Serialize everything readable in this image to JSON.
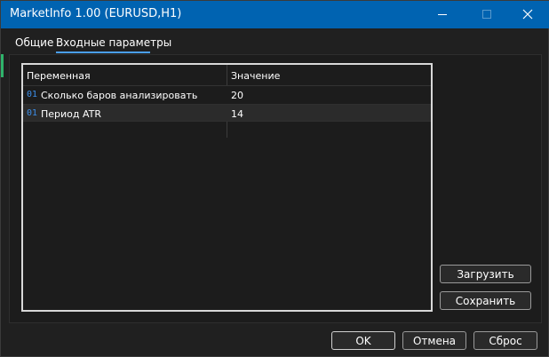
{
  "window": {
    "title": "MarketInfo 1.00 (EURUSD,H1)"
  },
  "titlebar_buttons": {
    "minimize": "minimize-icon",
    "maximize": "maximize-icon",
    "close": "close-icon"
  },
  "tabs": [
    {
      "label": "Общие",
      "active": false
    },
    {
      "label": "Входные параметры",
      "active": true
    }
  ],
  "table": {
    "columns": [
      "Переменная",
      "Значение"
    ],
    "rows": [
      {
        "type_icon": "01",
        "name": "Сколько баров анализировать",
        "value": "20"
      },
      {
        "type_icon": "01",
        "name": "Период ATR",
        "value": "14"
      }
    ]
  },
  "side_buttons": {
    "load": "Загрузить",
    "save": "Сохранить"
  },
  "footer_buttons": {
    "ok": "OK",
    "cancel": "Отмена",
    "reset": "Сброс"
  },
  "colors": {
    "titlebar": "#0063b1",
    "accent": "#4a9ff0",
    "type_icon": "#3c8ee8",
    "background": "#202020"
  }
}
